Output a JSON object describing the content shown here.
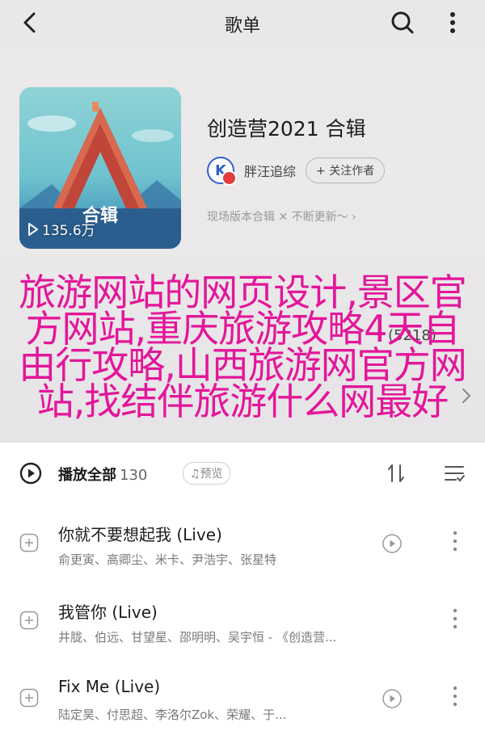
{
  "nav": {
    "title": "歌单",
    "back_icon": "back-arrow-icon",
    "search_icon": "search-icon",
    "more_icon": "more-vertical-icon"
  },
  "album": {
    "cover_caption": "合辑",
    "play_count": "135.6万",
    "title": "创造营2021 合辑",
    "creator_name": "胖汪追综",
    "creator_avatar_letter": "K",
    "follow_label": "+ 关注作者",
    "description": "现场版本合辑 ✕ 不断更新～ ›"
  },
  "actions": {
    "comment_count": "5218"
  },
  "overlay_text": "旅游网站的网页设计,景区官方网站,重庆旅游攻略4天自由行攻略,山西旅游网官方网站,找结伴旅游什么网最好",
  "list": {
    "play_all_label": "播放全部",
    "play_all_count": "130",
    "preview_label": "♫预览",
    "songs": [
      {
        "title": "你就不要想起我 (Live)",
        "artists": "俞更寅、高卿尘、米卡、尹浩宇、张星特"
      },
      {
        "title": "我管你 (Live)",
        "artists": "井胧、伯远、甘望星、邵明明、吴宇恒 - 《创造营..."
      },
      {
        "title": "Fix Me (Live)",
        "artists": "陆定昊、付思超、李洛尔Zok、荣耀、于..."
      }
    ]
  },
  "colors": {
    "overlay": "#e3169a",
    "creator_ring": "#2f63c8",
    "badge": "#e03c3c"
  }
}
